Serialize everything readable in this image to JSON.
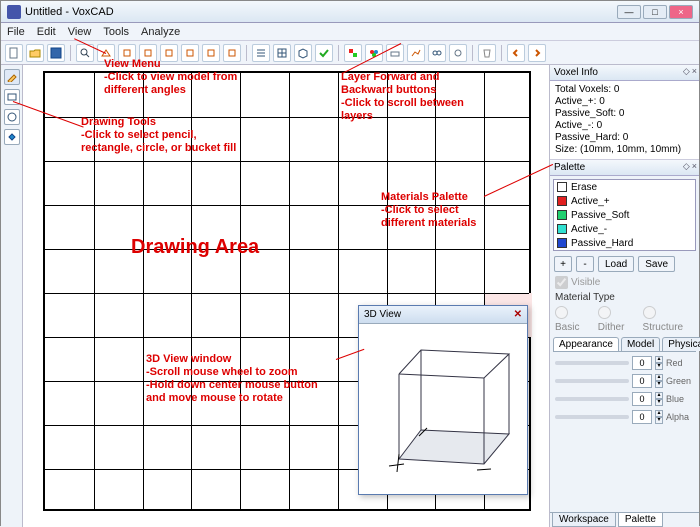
{
  "window": {
    "title": "Untitled - VoxCAD"
  },
  "menu": {
    "file": "File",
    "edit": "Edit",
    "view": "View",
    "tools": "Tools",
    "analyze": "Analyze"
  },
  "voxel_info": {
    "header": "Voxel Info",
    "total": "Total Voxels: 0",
    "active_p": "Active_+: 0",
    "passive_s": "Passive_Soft: 0",
    "active_m": "Active_-: 0",
    "passive_h": "Passive_Hard: 0",
    "size": "Size: (10mm, 10mm, 10mm)"
  },
  "palette": {
    "header": "Palette",
    "items": [
      {
        "name": "Erase",
        "color": "#ffffff"
      },
      {
        "name": "Active_+",
        "color": "#e02020"
      },
      {
        "name": "Passive_Soft",
        "color": "#20d070"
      },
      {
        "name": "Active_-",
        "color": "#30e0d0"
      },
      {
        "name": "Passive_Hard",
        "color": "#2048d0"
      }
    ],
    "add": "+",
    "remove": "-",
    "load": "Load",
    "save": "Save",
    "visible": "Visible",
    "material_type": "Material Type",
    "basic": "Basic",
    "dither": "Dither",
    "structure": "Structure",
    "tab_app": "Appearance",
    "tab_model": "Model",
    "tab_phys": "Physical",
    "sliders": [
      {
        "label": "Red",
        "value": "0"
      },
      {
        "label": "Green",
        "value": "0"
      },
      {
        "label": "Blue",
        "value": "0"
      },
      {
        "label": "Alpha",
        "value": "0"
      }
    ]
  },
  "bottom_tabs": {
    "workspace": "Workspace",
    "palette": "Palette"
  },
  "threed_view": {
    "title": "3D View"
  },
  "annot": {
    "view_menu": "View Menu\n-Click to view model from\ndifferent angles",
    "drawing_tools": "Drawing Tools\n-Click to select pencil,\nrectangle, circle, or bucket fill",
    "layer": "Layer Forward and\nBackward buttons\n-Click to scroll between\nlayers",
    "palette": "Materials Palette\n-Click to select\ndifferent materials",
    "area": "Drawing Area",
    "threed": "3D View window\n-Scroll mouse wheel to zoom\n-Hold down center mouse button\nand move mouse to rotate"
  }
}
